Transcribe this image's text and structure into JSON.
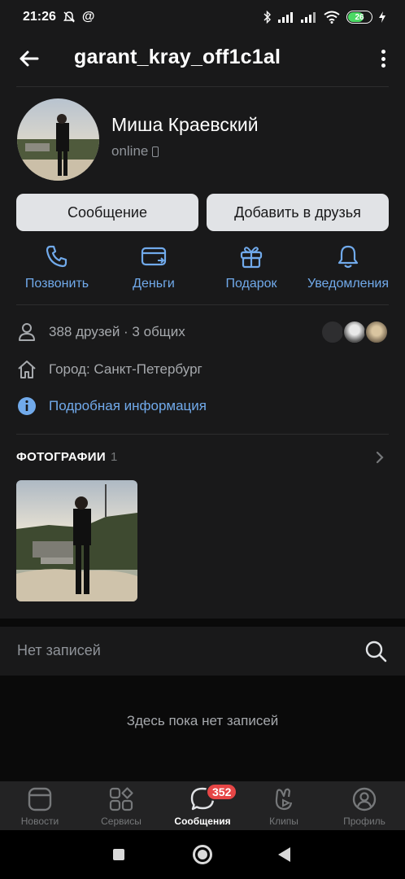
{
  "status_bar": {
    "time": "21:26",
    "battery": "26"
  },
  "header": {
    "title": "garant_kray_off1c1al"
  },
  "profile": {
    "name": "Миша Краевский",
    "status": "online",
    "message_button": "Сообщение",
    "add_friend_button": "Добавить в друзья"
  },
  "actions": [
    {
      "label": "Позвонить",
      "icon": "phone-icon"
    },
    {
      "label": "Деньги",
      "icon": "money-card-icon"
    },
    {
      "label": "Подарок",
      "icon": "gift-icon"
    },
    {
      "label": "Уведомления",
      "icon": "bell-icon"
    }
  ],
  "info": {
    "friends": "388 друзей · 3 общих",
    "city": "Город: Санкт-Петербург",
    "details_link": "Подробная информация"
  },
  "photos": {
    "title": "ФОТОГРАФИИ",
    "count": "1"
  },
  "wall": {
    "title": "Нет записей",
    "empty_text": "Здесь пока нет записей"
  },
  "tabbar": {
    "tabs": [
      {
        "label": "Новости",
        "icon": "news-icon"
      },
      {
        "label": "Сервисы",
        "icon": "services-icon"
      },
      {
        "label": "Сообщения",
        "icon": "messages-icon",
        "active": true
      },
      {
        "label": "Клипы",
        "icon": "clips-icon"
      },
      {
        "label": "Профиль",
        "icon": "profile-icon"
      }
    ],
    "messages_badge": "352"
  },
  "colors": {
    "accent": "#71aaeb",
    "badge": "#e64646",
    "background": "#19191a",
    "button": "#e1e3e6"
  }
}
